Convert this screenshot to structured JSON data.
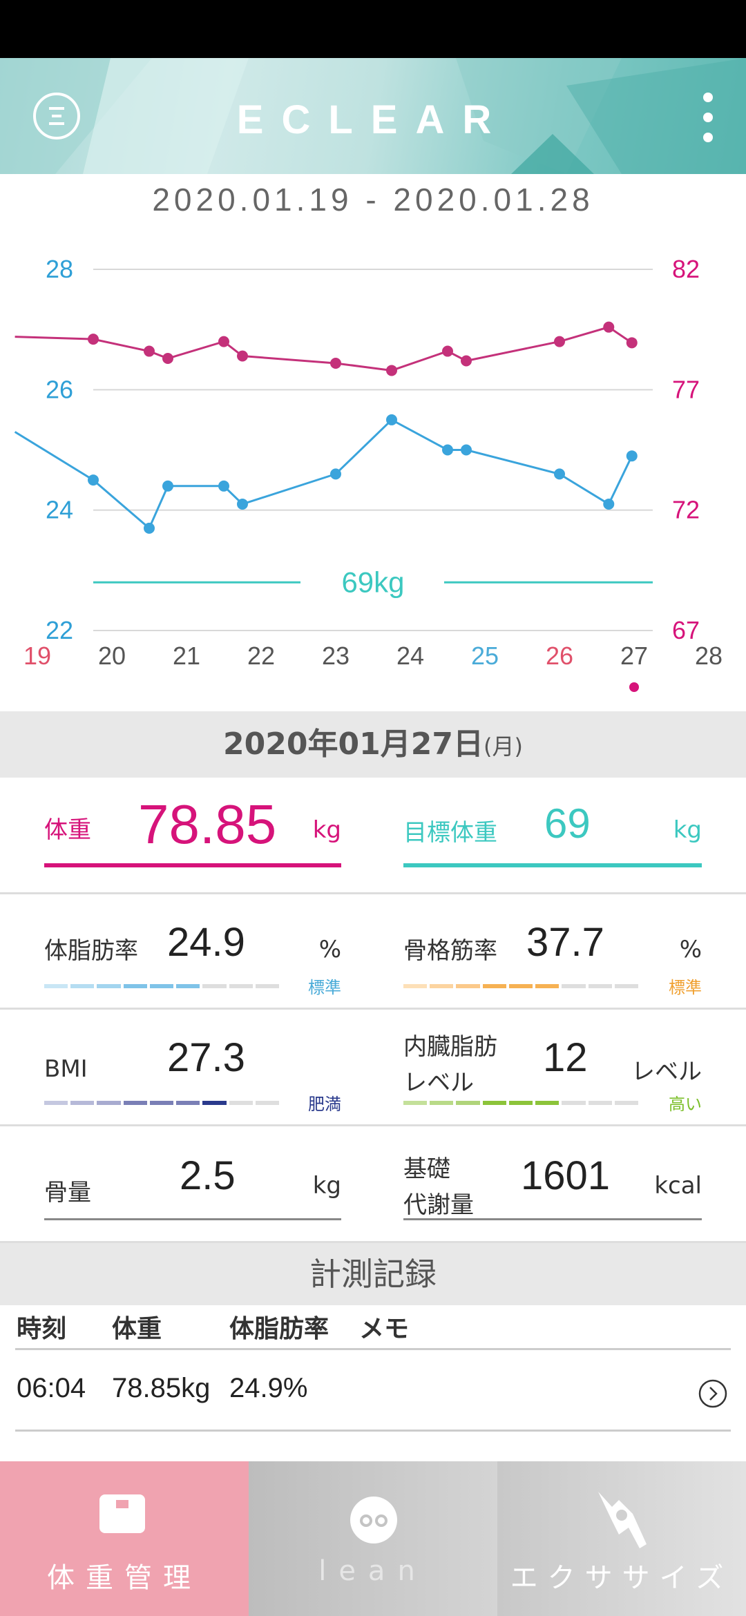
{
  "header": {
    "title": "ECLEAR"
  },
  "date_range": "2020.01.19 - 2020.01.28",
  "chart_data": {
    "type": "line",
    "x_ticks": [
      "19",
      "20",
      "21",
      "22",
      "23",
      "24",
      "25",
      "26",
      "27",
      "28"
    ],
    "x_tick_colors": [
      "#e0506a",
      "#555555",
      "#555555",
      "#555555",
      "#555555",
      "#555555",
      "#4aabd8",
      "#e0506a",
      "#555555",
      "#555555"
    ],
    "left_axis": {
      "ticks": [
        "28",
        "26",
        "24",
        "22"
      ],
      "ylim": [
        22,
        28
      ],
      "color": "#2e9fd6"
    },
    "right_axis": {
      "ticks": [
        "82",
        "77",
        "72",
        "67"
      ],
      "ylim": [
        67,
        82
      ],
      "color": "#d6137a"
    },
    "goal": {
      "label": "69kg",
      "value": 69
    },
    "series": [
      {
        "axis": "right",
        "color": "#c4317a",
        "x": [
          18.7,
          19.75,
          20.5,
          20.75,
          21.5,
          21.75,
          23.0,
          23.75,
          24.5,
          24.75,
          26.0,
          26.66,
          26.97
        ],
        "values": [
          79.2,
          79.1,
          78.6,
          78.3,
          79.0,
          78.4,
          78.1,
          77.8,
          78.6,
          78.2,
          79.0,
          79.6,
          78.95
        ]
      },
      {
        "axis": "left",
        "color": "#3aa4dc",
        "x": [
          18.7,
          19.75,
          20.5,
          20.75,
          21.5,
          21.75,
          23.0,
          23.75,
          24.5,
          24.75,
          26.0,
          26.66,
          26.97
        ],
        "values": [
          25.3,
          24.5,
          23.7,
          24.4,
          24.4,
          24.1,
          24.6,
          25.5,
          25.0,
          25.0,
          24.6,
          24.1,
          24.9
        ]
      }
    ],
    "selected_marker_x": 27
  },
  "date_band": {
    "date": "2020年01月27日",
    "weekday": "(月)"
  },
  "weight": {
    "label": "体重",
    "value": "78.85",
    "unit": "kg",
    "color": "#d6137a"
  },
  "goal_weight": {
    "label": "目標体重",
    "value": "69",
    "unit": "kg",
    "color": "#3cc8c0"
  },
  "body_fat": {
    "label": "体脂肪率",
    "value": "24.9",
    "unit": "%",
    "status": "標準",
    "status_color": "#4aabd8",
    "level": 6,
    "total": 9
  },
  "muscle": {
    "label": "骨格筋率",
    "value": "37.7",
    "unit": "%",
    "status": "標準",
    "status_color": "#f0a030",
    "level": 6,
    "total": 9
  },
  "bmi": {
    "label": "BMI",
    "value": "27.3",
    "unit": "",
    "status": "肥満",
    "status_color": "#2a3a8c",
    "level": 7,
    "total": 9
  },
  "visceral": {
    "label1": "内臓脂肪",
    "label2": "レベル",
    "value": "12",
    "unit": "レベル",
    "status": "高い",
    "status_color": "#7cbf2a",
    "level": 6,
    "total": 9
  },
  "bone": {
    "label": "骨量",
    "value": "2.5",
    "unit": "kg"
  },
  "metabolism": {
    "label1": "基礎",
    "label2": "代謝量",
    "value": "1601",
    "unit": "kcal"
  },
  "records": {
    "title": "計測記録",
    "headers": {
      "time": "時刻",
      "weight": "体重",
      "fat": "体脂肪率",
      "memo": "メモ"
    },
    "rows": [
      {
        "time": "06:04",
        "weight": "78.85kg",
        "fat": "24.9%"
      }
    ]
  },
  "nav": [
    {
      "label": "体重管理",
      "icon": "scale-icon"
    },
    {
      "label": "lean",
      "icon": "lean-face-icon"
    },
    {
      "label": "エクササイズ",
      "icon": "exercise-pose-icon"
    }
  ]
}
